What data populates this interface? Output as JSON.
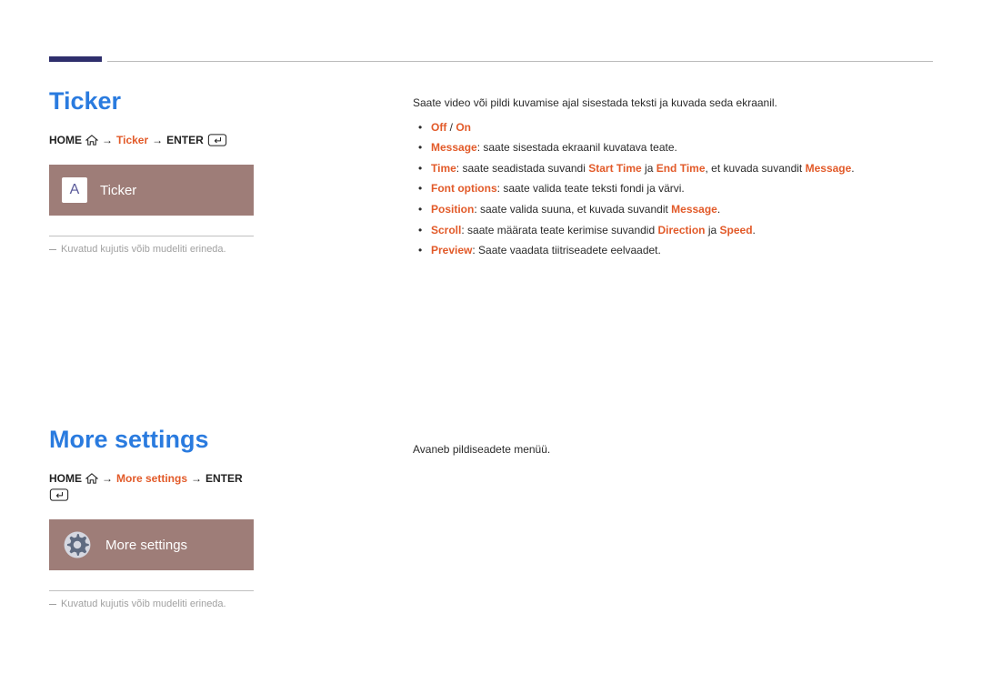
{
  "accent_bar_color": "#2e2e6c",
  "colors": {
    "section_title": "#2a7bdf",
    "highlight": "#e25a29",
    "tile_bg": "#9e7d78"
  },
  "section1": {
    "title": "Ticker",
    "crumb_home": "HOME",
    "crumb_target": "Ticker",
    "crumb_enter": "ENTER",
    "tile_icon": "A",
    "tile_label": "Ticker",
    "note": "Kuvatud kujutis võib mudeliti erineda.",
    "intro": "Saate video või pildi kuvamise ajal sisestada teksti ja kuvada seda ekraanil.",
    "bullets": {
      "b1_off": "Off",
      "b1_sep": " / ",
      "b1_on": "On",
      "b2_lead": "Message",
      "b2_rest": ": saate sisestada ekraanil kuvatava teate.",
      "b3_lead": "Time",
      "b3_a": ": saate seadistada suvandi ",
      "b3_h1": "Start Time",
      "b3_mid": " ja ",
      "b3_h2": "End Time",
      "b3_b": ", et kuvada suvandit ",
      "b3_h3": "Message",
      "b3_end": ".",
      "b4_lead": "Font options",
      "b4_rest": ": saate valida teate teksti fondi ja värvi.",
      "b5_lead": "Position",
      "b5_a": ": saate valida suuna, et kuvada suvandit ",
      "b5_h1": "Message",
      "b5_end": ".",
      "b6_lead": "Scroll",
      "b6_a": ": saate määrata teate kerimise suvandid ",
      "b6_h1": "Direction",
      "b6_mid": " ja ",
      "b6_h2": "Speed",
      "b6_end": ".",
      "b7_lead": "Preview",
      "b7_rest": ": Saate vaadata tiitriseadete eelvaadet."
    }
  },
  "section2": {
    "title": "More settings",
    "crumb_home": "HOME",
    "crumb_target": "More settings",
    "crumb_enter": "ENTER",
    "tile_label": "More settings",
    "note": "Kuvatud kujutis võib mudeliti erineda.",
    "intro": "Avaneb pildiseadete menüü."
  },
  "arrow": "→"
}
